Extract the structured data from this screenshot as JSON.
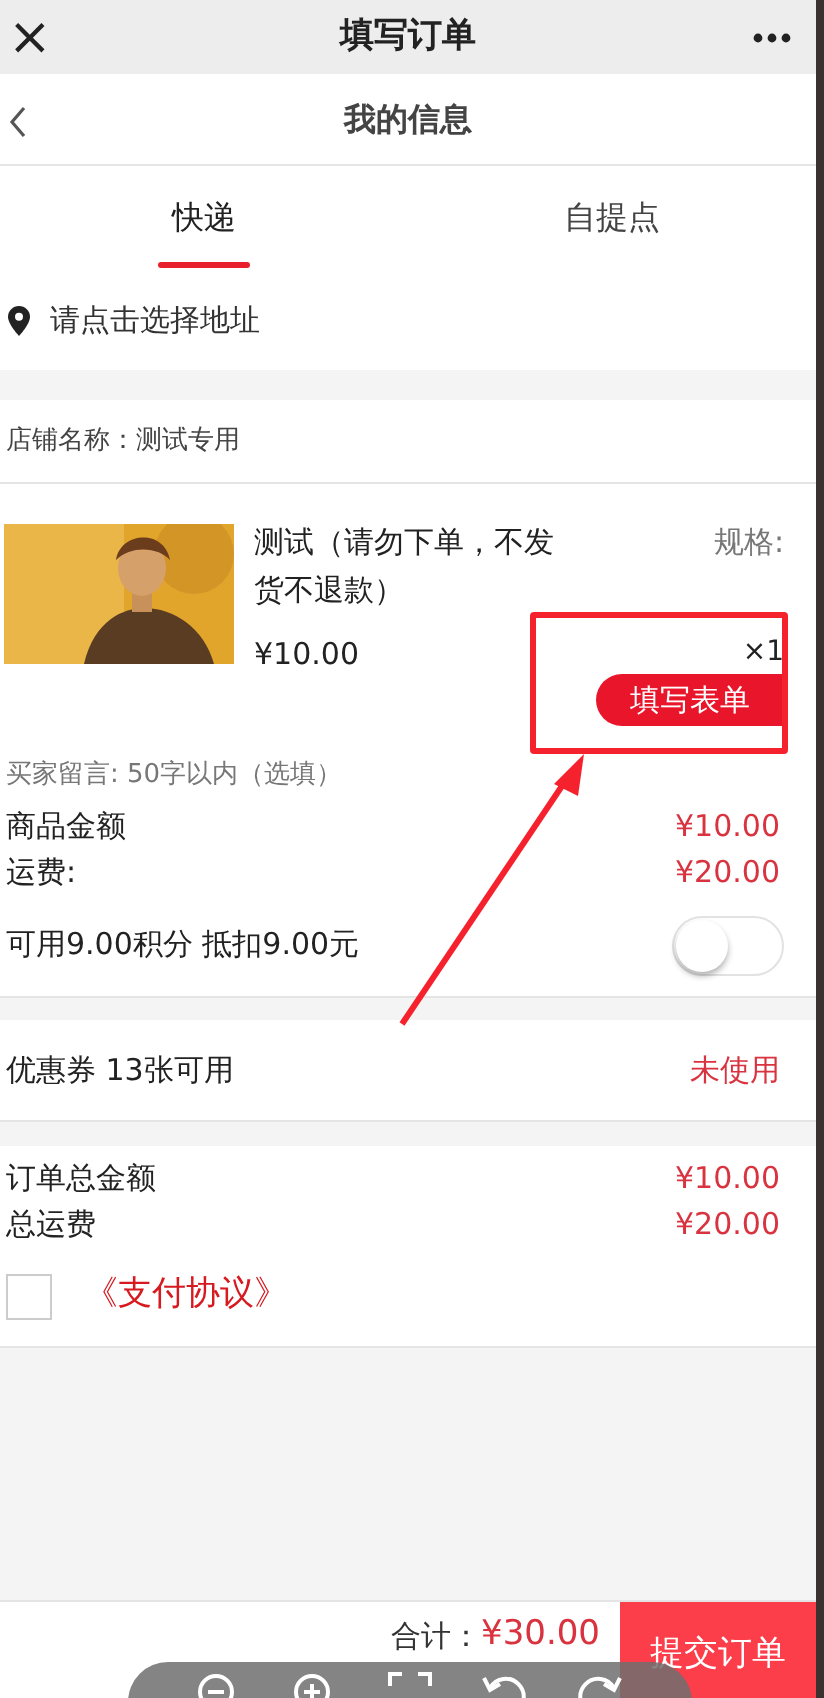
{
  "top_bar": {
    "title": "填写订单",
    "close": "×"
  },
  "header": {
    "title": "我的信息"
  },
  "tabs": [
    {
      "label": "快递",
      "selected": true
    },
    {
      "label": "自提点",
      "selected": false
    }
  ],
  "address": {
    "placeholder": "请点击选择地址"
  },
  "store": {
    "label": "店铺名称：测试专用"
  },
  "product": {
    "title": "测试（请勿下单，不发货不退款）",
    "spec": "规格:",
    "price": "¥10.00",
    "quantity": "×1",
    "form_button": "填写表单"
  },
  "message": {
    "placeholder": "买家留言: 50字以内（选填）"
  },
  "summary": [
    {
      "label": "商品金额",
      "value": "¥10.00"
    },
    {
      "label": "运费:",
      "value": "¥20.00"
    }
  ],
  "points": {
    "label": "可用9.00积分 抵扣9.00元",
    "on": false
  },
  "coupon": {
    "label": "优惠券 13张可用",
    "value": "未使用"
  },
  "totals": [
    {
      "label": "订单总金额",
      "value": "¥10.00"
    },
    {
      "label": "总运费",
      "value": "¥20.00"
    }
  ],
  "agreement": {
    "checked": false,
    "link": "《支付协议》"
  },
  "bottom_bar": {
    "total_label": "合计：",
    "total": "¥30.00",
    "submit": "提交订单"
  }
}
